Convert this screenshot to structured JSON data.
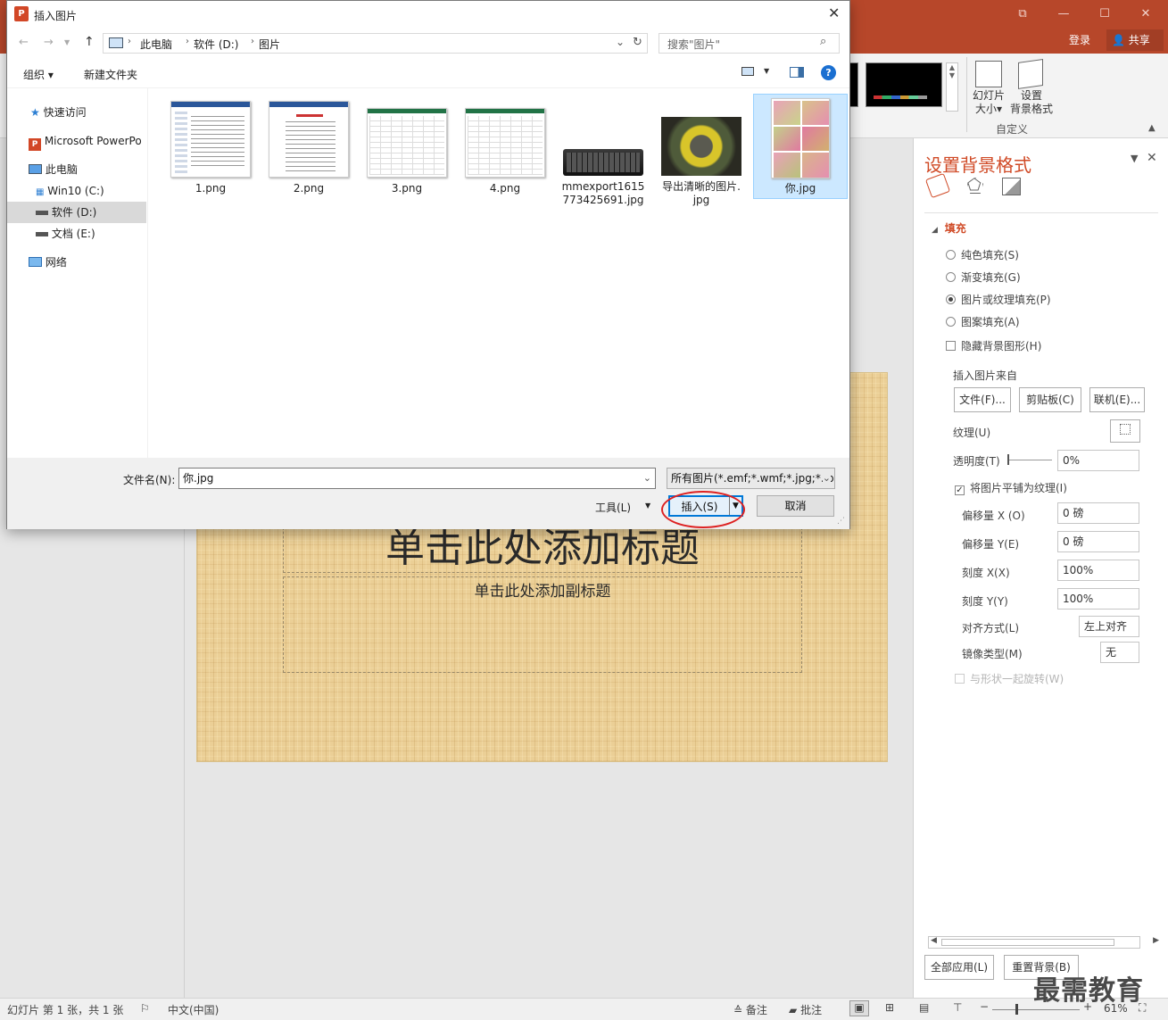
{
  "ppt": {
    "window_controls": {
      "ribbon_toggle": "⧉",
      "minimize": "—",
      "maximize": "☐",
      "close": "✕"
    },
    "login": "登录",
    "share": "共享",
    "ribbon": {
      "slide_size_label": "幻灯片\n大小▾",
      "format_bg_label": "设置\n背景格式",
      "group_custom": "自定义"
    }
  },
  "slide": {
    "title": "单击此处添加标题",
    "subtitle": "单击此处添加副标题"
  },
  "format_pane": {
    "title": "设置背景格式",
    "section_fill": "填充",
    "options": {
      "solid": "纯色填充(S)",
      "gradient": "渐变填充(G)",
      "picture": "图片或纹理填充(P)",
      "pattern": "图案填充(A)",
      "hide_bg": "隐藏背景图形(H)"
    },
    "insert_from": "插入图片来自",
    "btn_file": "文件(F)...",
    "btn_clipboard": "剪贴板(C)",
    "btn_online": "联机(E)...",
    "texture": "纹理(U)",
    "transparency": "透明度(T)",
    "transparency_value": "0%",
    "tile": "将图片平铺为纹理(I)",
    "offset_x": "偏移量 X (O)",
    "offset_x_value": "0 磅",
    "offset_y": "偏移量 Y(E)",
    "offset_y_value": "0 磅",
    "scale_x": "刻度 X(X)",
    "scale_x_value": "100%",
    "scale_y": "刻度 Y(Y)",
    "scale_y_value": "100%",
    "align": "对齐方式(L)",
    "align_value": "左上对齐",
    "mirror": "镜像类型(M)",
    "mirror_value": "无",
    "rotate": "与形状一起旋转(W)",
    "apply_all": "全部应用(L)",
    "reset_bg": "重置背景(B)"
  },
  "statusbar": {
    "slide_info": "幻灯片 第 1 张，共 1 张",
    "language": "中文(中国)",
    "notes": "备注",
    "comments": "批注",
    "zoom": "61%"
  },
  "dialog": {
    "title": "插入图片",
    "breadcrumb": [
      "此电脑",
      "软件 (D:)",
      "图片"
    ],
    "search_placeholder": "搜索\"图片\"",
    "organize": "组织 ▾",
    "new_folder": "新建文件夹",
    "nav": {
      "quick_access": "快速访问",
      "powerpoint": "Microsoft PowerPo",
      "this_pc": "此电脑",
      "c_drive": "Win10 (C:)",
      "d_drive": "软件 (D:)",
      "e_drive": "文档 (E:)",
      "network": "网络"
    },
    "files": [
      {
        "name": "1.png"
      },
      {
        "name": "2.png"
      },
      {
        "name": "3.png"
      },
      {
        "name": "4.png"
      },
      {
        "name": "mmexport1615\n773425691.jpg"
      },
      {
        "name": "导出清晰的图片.\njpg"
      },
      {
        "name": "你.jpg"
      }
    ],
    "filename_label": "文件名(N):",
    "filename_value": "你.jpg",
    "filetype_value": "所有图片(*.emf;*.wmf;*.jpg;*.jp",
    "tools": "工具(L)",
    "insert": "插入(S)",
    "cancel": "取消"
  },
  "watermark": "最需教育"
}
